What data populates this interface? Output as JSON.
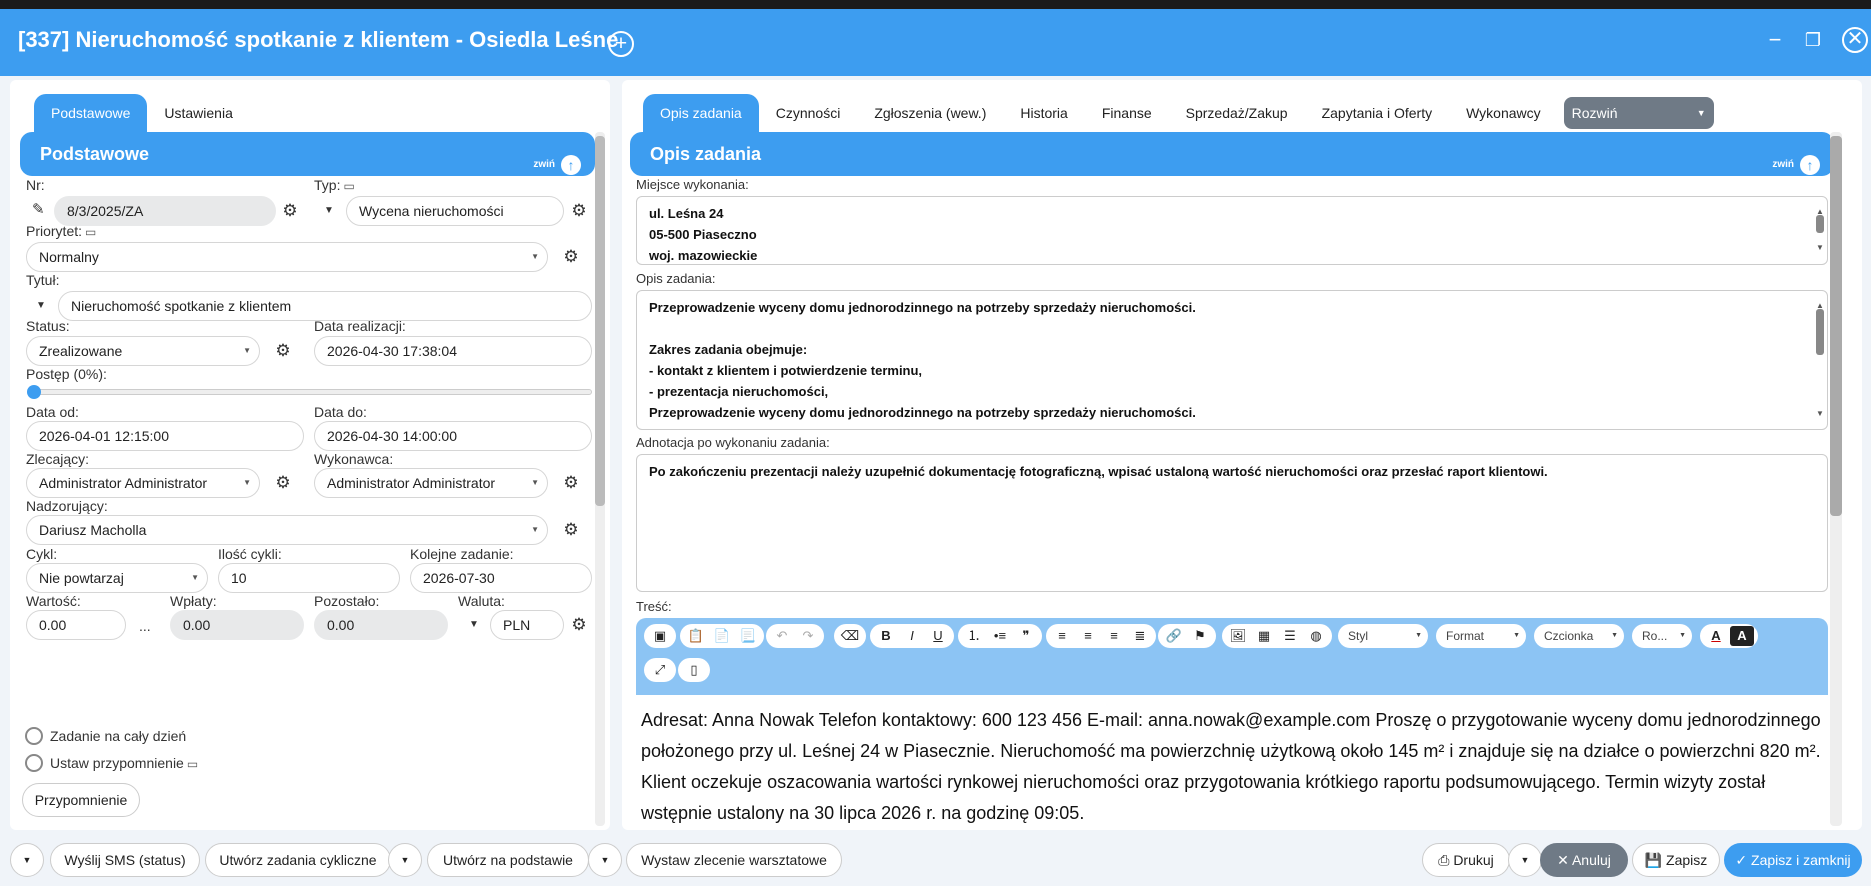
{
  "window": {
    "title": "[337] Nieruchomość spotkanie z klientem - Osiedla Leśne",
    "plus": "+",
    "min": "−",
    "restore": "❐",
    "close": "✕"
  },
  "left": {
    "tabs": [
      "Podstawowe",
      "Ustawienia"
    ],
    "section_title": "Podstawowe",
    "collapse_label": "zwiń",
    "nr_label": "Nr:",
    "nr_value": "8/3/2025/ZA",
    "typ_label": "Typ:",
    "typ_value": "Wycena nieruchomości",
    "priorytet_label": "Priorytet:",
    "priorytet_value": "Normalny",
    "tytul_label": "Tytuł:",
    "tytul_value": "Nieruchomość spotkanie z klientem",
    "status_label": "Status:",
    "status_value": "Zrealizowane",
    "data_realizacji_label": "Data realizacji:",
    "data_realizacji_value": "2026-04-30 17:38:04",
    "postep_label": "Postęp (0%):",
    "postep_value": 0,
    "data_od_label": "Data od:",
    "data_od_value": "2026-04-01 12:15:00",
    "data_do_label": "Data do:",
    "data_do_value": "2026-04-30 14:00:00",
    "zlecajacy_label": "Zlecający:",
    "zlecajacy_value": "Administrator Administrator",
    "wykonawca_label": "Wykonawca:",
    "wykonawca_value": "Administrator Administrator",
    "nadzorujacy_label": "Nadzorujący:",
    "nadzorujacy_value": "Dariusz Macholla",
    "cykl_label": "Cykl:",
    "cykl_value": "Nie powtarzaj",
    "ilosc_label": "Ilość cykli:",
    "ilosc_value": "10",
    "kolejne_label": "Kolejne zadanie:",
    "kolejne_value": "2026-07-30",
    "wartosc_label": "Wartość:",
    "wartosc_value": "0.00",
    "wartosc_ellipsis": "...",
    "wplaty_label": "Wpłaty:",
    "wplaty_value": "0.00",
    "pozostalo_label": "Pozostało:",
    "pozostalo_value": "0.00",
    "waluta_label": "Waluta:",
    "waluta_value": "PLN",
    "caly_dzien_label": "Zadanie na cały dzień",
    "przypomnienie_label": "Ustaw przypomnienie",
    "przypomnienie_button": "Przypomnienie"
  },
  "right": {
    "tabs": [
      "Opis zadania",
      "Czynności",
      "Zgłoszenia (wew.)",
      "Historia",
      "Finanse",
      "Sprzedaż/Zakup",
      "Zapytania i Oferty",
      "Wykonawcy"
    ],
    "expand_label": "Rozwiń",
    "section_title": "Opis zadania",
    "collapse_label": "zwiń",
    "miejsce_label": "Miejsce wykonania:",
    "miejsce_lines": [
      "ul. Leśna 24",
      "05-500 Piaseczno",
      "woj. mazowieckie"
    ],
    "opis_label": "Opis zadania:",
    "opis_lines": [
      "Przeprowadzenie wyceny domu jednorodzinnego na potrzeby sprzedaży nieruchomości.",
      "",
      "Zakres zadania obejmuje:",
      "- kontakt z klientem i potwierdzenie terminu,",
      "- prezentacja nieruchomości,",
      "Przeprowadzenie wyceny domu jednorodzinnego na potrzeby sprzedaży nieruchomości."
    ],
    "adnotacja_label": "Adnotacja po wykonaniu zadania:",
    "adnotacja_value": "Po zakończeniu prezentacji należy uzupełnić dokumentację fotograficzną, wpisać ustaloną wartość nieruchomości oraz przesłać raport klientowi.",
    "tresc_label": "Treść:",
    "toolbar": {
      "styl": "Styl",
      "format": "Format",
      "czcionka": "Czcionka",
      "rozmiar": "Ro..."
    },
    "tresc_value": "Adresat: Anna Nowak Telefon kontaktowy: 600 123 456 E-mail: anna.nowak@example.com Proszę o przygotowanie wyceny domu jednorodzinnego położonego przy ul. Leśnej 24 w Piasecznie. Nieruchomość ma powierzchnię użytkową około 145 m² i znajduje się na działce o powierzchni 820 m². Klient oczekuje oszacowania wartości rynkowej nieruchomości oraz przygotowania krótkiego raportu podsumowującego. Termin wizyty został wstępnie ustalony na 30 lipca 2026 r. na godzinę 09:05."
  },
  "footer": {
    "sms": "Wyślij SMS (status)",
    "cykliczne": "Utwórz zadania cykliczne",
    "na_podstawie": "Utwórz na podstawie",
    "warsztatowe": "Wystaw zlecenie warsztatowe",
    "drukuj": "Drukuj",
    "anuluj": "Anuluj",
    "zapisz": "Zapisz",
    "zapisz_zamknij": "Zapisz i zamknij"
  },
  "colors": {
    "accent": "#3d9df0",
    "cancel": "#6f7a86"
  }
}
